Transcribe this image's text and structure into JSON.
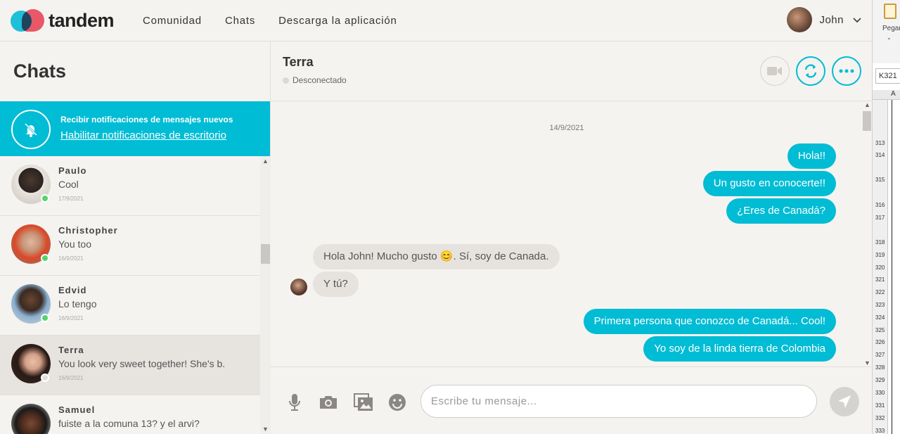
{
  "brand": {
    "name": "tandem",
    "teal": "#00bcd4",
    "coral": "#f25c6e"
  },
  "nav": {
    "links": [
      "Comunidad",
      "Chats",
      "Descarga la aplicación"
    ]
  },
  "user": {
    "name": "John"
  },
  "sidebar": {
    "title": "Chats",
    "notification": {
      "title": "Recibir notificaciones de mensajes nuevos",
      "link": "Habilitar notificaciones de escritorio"
    },
    "chats": [
      {
        "name": "Paulo",
        "last_message": "Cool",
        "date": "17/9/2021",
        "online": true
      },
      {
        "name": "Christopher",
        "last_message": "You too",
        "date": "16/9/2021",
        "online": true
      },
      {
        "name": "Edvid",
        "last_message": "Lo tengo",
        "date": "16/9/2021",
        "online": true
      },
      {
        "name": "Terra",
        "last_message": "You look very sweet together! She's b.",
        "date": "16/9/2021",
        "online": false,
        "active": true
      },
      {
        "name": "Samuel",
        "last_message": "fuiste a la comuna 13? y el arvi?",
        "date": "",
        "online": false
      }
    ]
  },
  "conversation": {
    "name": "Terra",
    "status": "Desconectado",
    "date_separator": "14/9/2021",
    "messages": [
      {
        "dir": "out",
        "text": "Hola!!"
      },
      {
        "dir": "out",
        "text": "Un gusto en conocerte!!"
      },
      {
        "dir": "out",
        "text": "¿Eres de Canadá?"
      },
      {
        "dir": "in",
        "text": "Hola John! Mucho gusto 😊. Sí, soy de Canada."
      },
      {
        "dir": "in",
        "text": "Y tú?"
      },
      {
        "dir": "out",
        "text": "Primera persona que conozco de Canadá... Cool!"
      },
      {
        "dir": "out",
        "text": "Yo soy de la linda tierra de Colombia"
      }
    ]
  },
  "composer": {
    "placeholder": "Escribe tu mensaje..."
  },
  "spreadsheet": {
    "paste_label": "Pegar",
    "name_box": "K321",
    "column": "A",
    "rows": [
      "313",
      "314",
      "315",
      "316",
      "317",
      "318",
      "319",
      "320",
      "321",
      "322",
      "323",
      "324",
      "325",
      "326",
      "327",
      "328",
      "329",
      "330",
      "331",
      "332",
      "333"
    ]
  }
}
